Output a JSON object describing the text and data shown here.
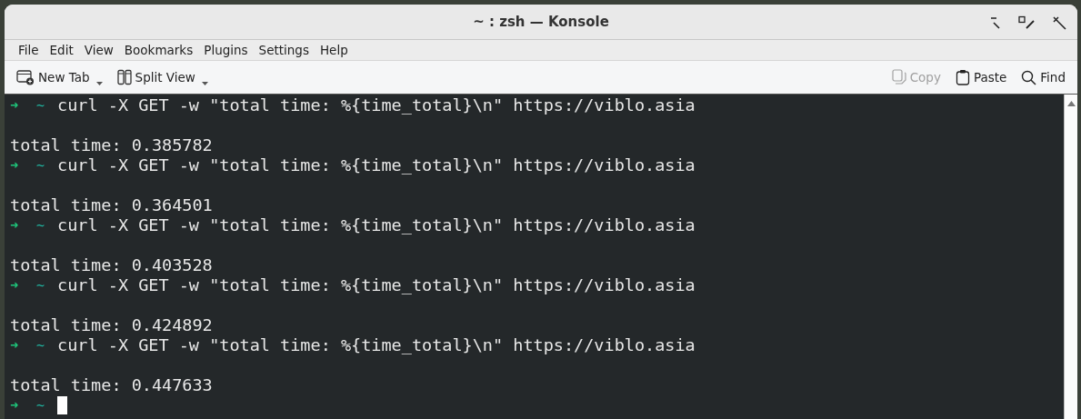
{
  "window": {
    "title": "~ : zsh — Konsole"
  },
  "menu": [
    "File",
    "Edit",
    "View",
    "Bookmarks",
    "Plugins",
    "Settings",
    "Help"
  ],
  "toolbar_left": [
    {
      "label": "New Tab",
      "kind": "newtab",
      "dropdown": true
    },
    {
      "label": "Split View",
      "kind": "split",
      "dropdown": true
    }
  ],
  "toolbar_right": [
    {
      "label": "Copy",
      "kind": "copy",
      "disabled": true
    },
    {
      "label": "Paste",
      "kind": "paste",
      "disabled": false
    },
    {
      "label": "Find",
      "kind": "find",
      "disabled": false
    }
  ],
  "terminal": {
    "lines": [
      {
        "kind": "prompt",
        "arrow": "➜",
        "dir": "~",
        "command": "curl -X GET -w \"total time: %{time_total}\\n\" https://viblo.asia"
      },
      {
        "kind": "blank"
      },
      {
        "kind": "output",
        "text": "total time: 0.385782"
      },
      {
        "kind": "prompt",
        "arrow": "➜",
        "dir": "~",
        "command": "curl -X GET -w \"total time: %{time_total}\\n\" https://viblo.asia"
      },
      {
        "kind": "blank"
      },
      {
        "kind": "output",
        "text": "total time: 0.364501"
      },
      {
        "kind": "prompt",
        "arrow": "➜",
        "dir": "~",
        "command": "curl -X GET -w \"total time: %{time_total}\\n\" https://viblo.asia"
      },
      {
        "kind": "blank"
      },
      {
        "kind": "output",
        "text": "total time: 0.403528"
      },
      {
        "kind": "prompt",
        "arrow": "➜",
        "dir": "~",
        "command": "curl -X GET -w \"total time: %{time_total}\\n\" https://viblo.asia"
      },
      {
        "kind": "blank"
      },
      {
        "kind": "output",
        "text": "total time: 0.424892"
      },
      {
        "kind": "prompt",
        "arrow": "➜",
        "dir": "~",
        "command": "curl -X GET -w \"total time: %{time_total}\\n\" https://viblo.asia"
      },
      {
        "kind": "blank"
      },
      {
        "kind": "output",
        "text": "total time: 0.447633"
      },
      {
        "kind": "prompt",
        "arrow": "➜",
        "dir": "~",
        "cursor": true
      }
    ]
  }
}
